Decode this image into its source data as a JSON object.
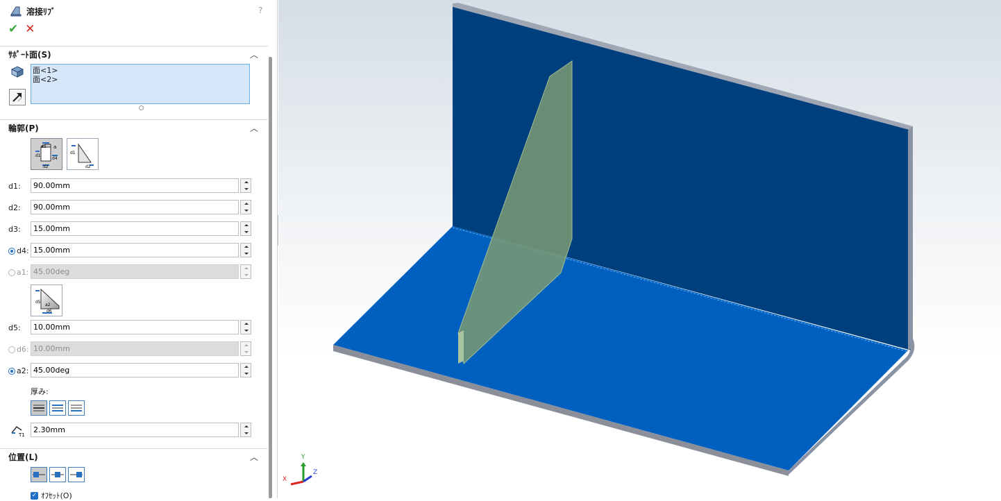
{
  "panel": {
    "title": "溶接ﾘﾌﾞ",
    "help": "?",
    "ok_glyph": "✔",
    "cancel_glyph": "✕",
    "support": {
      "title": "ｻﾎﾟｰﾄ面(S)",
      "faces": [
        "面<1>",
        "面<2>"
      ]
    },
    "profile": {
      "title": "輪郭(P)",
      "fields": [
        {
          "label": "d1:",
          "value": "90.00mm",
          "enabled": true
        },
        {
          "label": "d2:",
          "value": "90.00mm",
          "enabled": true
        },
        {
          "label": "d3:",
          "value": "15.00mm",
          "enabled": true
        },
        {
          "label": "d4:",
          "value": "15.00mm",
          "enabled": true
        },
        {
          "label": "a1:",
          "value": "45.00deg",
          "enabled": false
        },
        {
          "label": "d5:",
          "value": "10.00mm",
          "enabled": true
        },
        {
          "label": "d6:",
          "value": "10.00mm",
          "enabled": false
        },
        {
          "label": "a2:",
          "value": "45.00deg",
          "enabled": true
        }
      ],
      "thickness_label": "厚み:",
      "thickness_value": "2.30mm",
      "thickness_symbol": "T1"
    },
    "position": {
      "title": "位置(L)",
      "offset_label": "ｵﾌｾｯﾄ(O)",
      "offset_checked": true
    }
  },
  "viewport": {
    "triad": {
      "x": "X",
      "y": "Y",
      "z": "Z"
    },
    "colors": {
      "vertical_plate": "#003f7d",
      "horizontal_plate": "#0060c0",
      "rib": "#7a9a72",
      "edge": "#8a8f99"
    }
  }
}
